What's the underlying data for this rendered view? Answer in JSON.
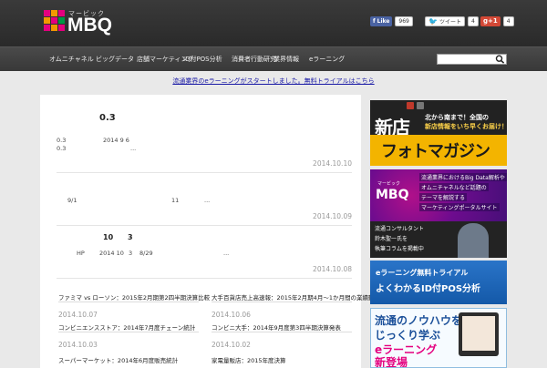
{
  "header": {
    "logo_sub": "マービック",
    "logo_text": "MBQ",
    "logo_colors": [
      "#e4007f",
      "#f39800",
      "#e4007f",
      "#f39800",
      "#e4007f",
      "#009944",
      "#e4007f",
      "#f39800",
      "#e4007f"
    ],
    "facebook": {
      "label": "Like",
      "count": "969"
    },
    "twitter": {
      "label": "ツイート",
      "count": "4"
    },
    "gplus": {
      "label": "g+1",
      "count": "4"
    }
  },
  "nav": {
    "items": [
      {
        "label": "オムニチャネル"
      },
      {
        "label": "ビッグデータ"
      },
      {
        "label": "店舗マーケティング"
      },
      {
        "label": "ID付POS分析"
      },
      {
        "label": "消費者行動研究"
      },
      {
        "label": "業界情報"
      },
      {
        "label": "eラーニング"
      }
    ],
    "search_placeholder": ""
  },
  "announcement": "流通業界のeラーニングがスタートしました。無料トライアルはこちら",
  "posts": [
    {
      "title": "0.3",
      "excerpt_1": "0.3",
      "excerpt_date": "2014 9 6",
      "excerpt_2": "0.3",
      "ellipsis": "...",
      "date": "2014.10.10"
    },
    {
      "excerpt_1": "9/1",
      "excerpt_num": "11",
      "ellipsis": "...",
      "date": "2014.10.09"
    },
    {
      "title_a": "10",
      "title_b": "3",
      "excerpt_1": "HP",
      "excerpt_date": "2014 10",
      "excerpt_num": "3",
      "excerpt_date2": "8/29",
      "ellipsis": "...",
      "date": "2014.10.08"
    }
  ],
  "grid": [
    {
      "title": "ファミマ vs ローソン：2015年2月期第2四半期決算比較",
      "date": "2014.10.07"
    },
    {
      "title": "大手百貨店売上高速報：2015年2月期4月～1か月間の業績動向まとめ",
      "date": "2014.10.06"
    },
    {
      "title": "コンビニエンスストア：2014年7月度チェーン統計",
      "date": "2014.10.03"
    },
    {
      "title": "コンビニ大手：2014年9月度第3四半期決算発表",
      "date": "2014.10.02"
    },
    {
      "title": "スーパーマーケット：2014年6月度販売統計",
      "date": ""
    },
    {
      "title": "家電量販店：2015年度決算",
      "date": ""
    }
  ],
  "sidebar": {
    "banner1": {
      "title": "新店",
      "slogan_1": "北から南まで！全国の",
      "slogan_2": "新店情報をいち早くお届け！",
      "mag": "フォトマガジン"
    },
    "banner2": {
      "logo_sub": "マービック",
      "logo": "MBQ",
      "lines": [
        "流通業界におけるBig Data解析や",
        "オムニチャネルなど話題の",
        "テーマを解説する",
        "マーケティングポータルサイト"
      ],
      "foot": [
        "流通コンサルタント",
        "鈴木聖一氏を",
        "執筆コラムを掲載中"
      ]
    },
    "banner3": {
      "line_1": "eラーニング無料トライアル",
      "line_2": "よくわかるID付POS分析"
    },
    "banner4": {
      "line_1": "流通のノウハウを",
      "line_2": "じっくり学ぶ",
      "line_3": "eラーニング",
      "line_4": "新登場"
    }
  }
}
